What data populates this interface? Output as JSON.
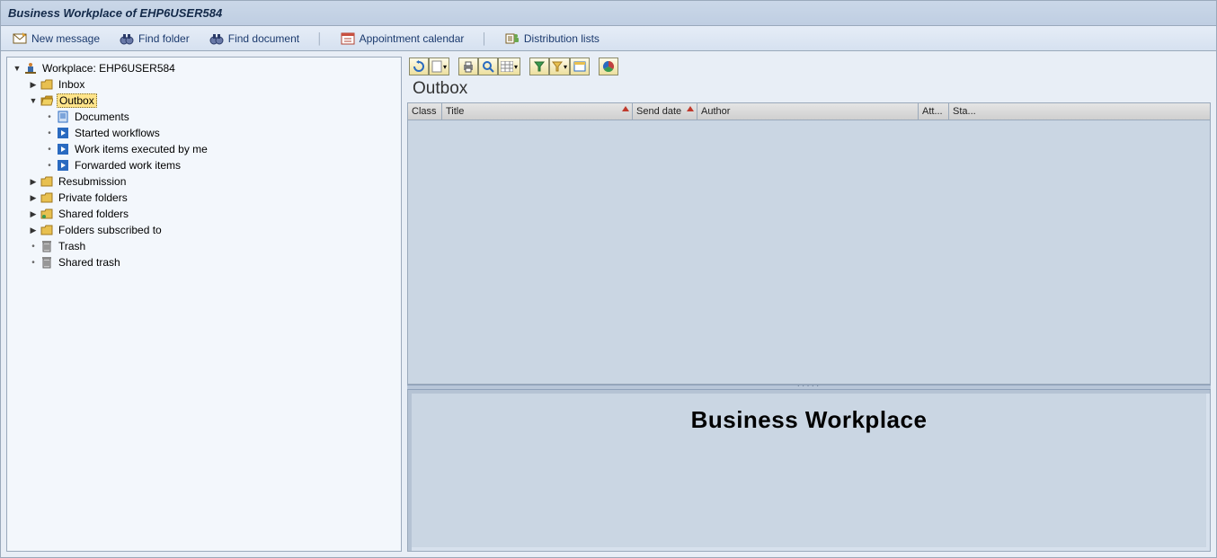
{
  "title": "Business Workplace of EHP6USER584",
  "toolbar": {
    "new_message": "New message",
    "find_folder": "Find folder",
    "find_document": "Find document",
    "appointment_calendar": "Appointment calendar",
    "distribution_lists": "Distribution lists"
  },
  "tree": {
    "root": "Workplace: EHP6USER584",
    "inbox": "Inbox",
    "outbox": "Outbox",
    "outbox_children": {
      "documents": "Documents",
      "started_workflows": "Started workflows",
      "work_items_executed": "Work items executed by me",
      "forwarded_work_items": "Forwarded work items"
    },
    "resubmission": "Resubmission",
    "private_folders": "Private folders",
    "shared_folders": "Shared folders",
    "folders_subscribed_to": "Folders subscribed to",
    "trash": "Trash",
    "shared_trash": "Shared trash"
  },
  "list": {
    "heading": "Outbox",
    "columns": {
      "class": "Class",
      "title": "Title",
      "send_date": "Send date",
      "author": "Author",
      "att": "Att...",
      "sta": "Sta..."
    }
  },
  "preview": {
    "heading": "Business Workplace"
  }
}
